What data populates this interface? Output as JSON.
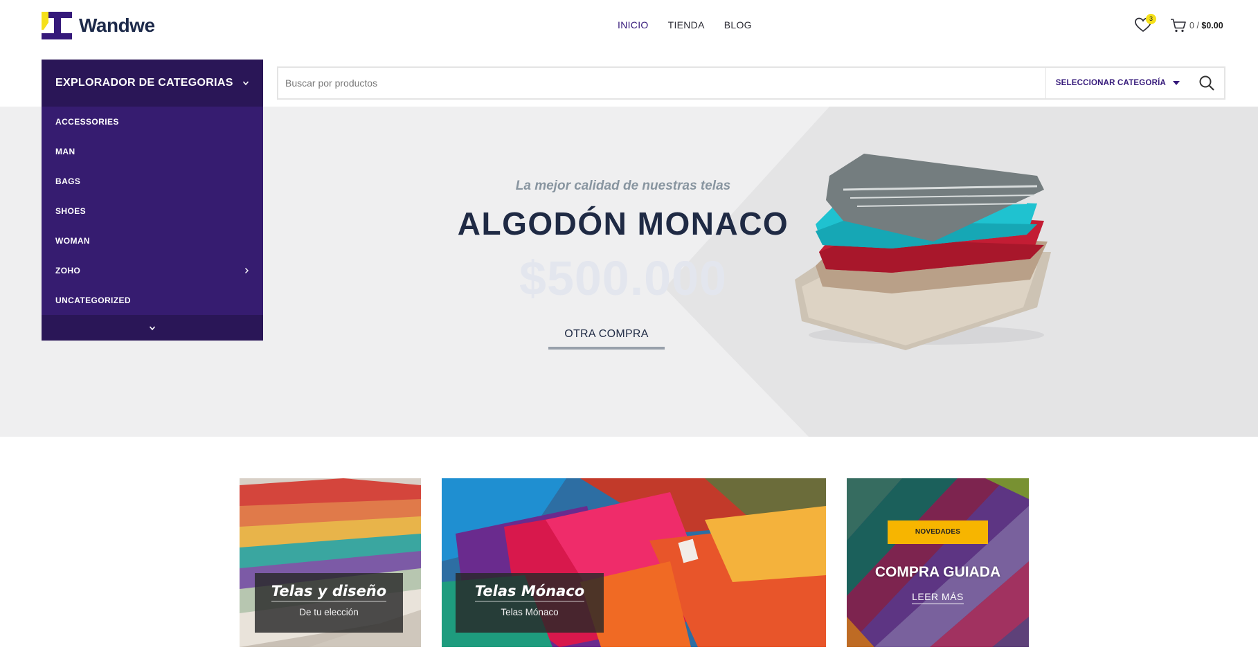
{
  "header": {
    "brand": "Wandwe",
    "nav": [
      {
        "label": "INICIO",
        "active": true
      },
      {
        "label": "TIENDA",
        "active": false
      },
      {
        "label": "BLOG",
        "active": false
      }
    ],
    "wishlist_count": "3",
    "cart_count": "0",
    "cart_separator": "/",
    "cart_total": "$0.00"
  },
  "categories": {
    "title": "EXPLORADOR DE CATEGORIAS",
    "items": [
      {
        "label": "ACCESSORIES"
      },
      {
        "label": "MAN"
      },
      {
        "label": "BAGS"
      },
      {
        "label": "SHOES"
      },
      {
        "label": "WOMAN"
      },
      {
        "label": "ZOHO"
      },
      {
        "label": "UNCATEGORIZED"
      }
    ]
  },
  "search": {
    "placeholder": "Buscar por productos",
    "category_label": "SELECCIONAR CATEGORÍA"
  },
  "hero": {
    "subtitle": "La mejor calidad de nuestras telas",
    "title": "ALGODÓN MONACO",
    "price": "$500.000",
    "button": "OTRA COMPRA"
  },
  "banners": [
    {
      "title": "Telas y diseño",
      "subtitle": "De tu elección"
    },
    {
      "title": "Telas Mónaco",
      "subtitle": "Telas Mónaco"
    },
    {
      "badge": "NOVEDADES",
      "title": "COMPRA GUIADA",
      "link": "LEER MÁS"
    }
  ],
  "colors": {
    "brand_purple": "#35197a",
    "brand_purple_dark": "#2a1657",
    "brand_yellow": "#f5e01a",
    "badge_orange": "#f7b500",
    "hero_bg": "#efeff0"
  },
  "icons": {
    "wishlist": "heart-icon",
    "cart": "cart-icon",
    "search": "search-icon",
    "category_toggle": "chevron-down-icon",
    "submenu": "chevron-right-icon",
    "more": "chevron-down-icon",
    "select": "caret-down-icon"
  }
}
